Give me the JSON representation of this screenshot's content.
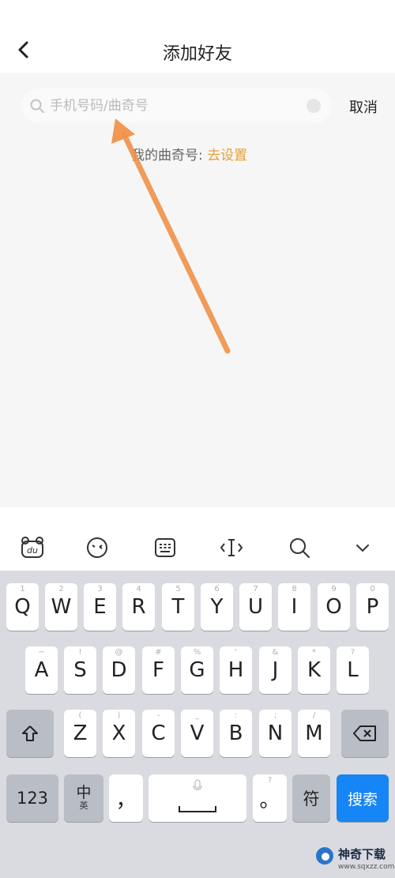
{
  "header": {
    "title": "添加好友"
  },
  "search": {
    "placeholder": "手机号码/曲奇号",
    "value": "",
    "cancel_label": "取消"
  },
  "quqi_id": {
    "label": "我的曲奇号:",
    "link_label": "去设置"
  },
  "keyboard_toolbar": {
    "items": [
      "du-logo-icon",
      "emoji-icon",
      "keyboard-icon",
      "cursor-icon",
      "search-icon",
      "chevron-down-icon"
    ]
  },
  "keyboard": {
    "row1": [
      {
        "key": "Q",
        "hint": "1"
      },
      {
        "key": "W",
        "hint": "2"
      },
      {
        "key": "E",
        "hint": "3"
      },
      {
        "key": "R",
        "hint": "4"
      },
      {
        "key": "T",
        "hint": "5"
      },
      {
        "key": "Y",
        "hint": "6"
      },
      {
        "key": "U",
        "hint": "7"
      },
      {
        "key": "I",
        "hint": "8"
      },
      {
        "key": "O",
        "hint": "9"
      },
      {
        "key": "P",
        "hint": "0"
      }
    ],
    "row2": [
      {
        "key": "A",
        "hint": "~"
      },
      {
        "key": "S",
        "hint": "!"
      },
      {
        "key": "D",
        "hint": "@"
      },
      {
        "key": "F",
        "hint": "#"
      },
      {
        "key": "G",
        "hint": "%"
      },
      {
        "key": "H",
        "hint": "'"
      },
      {
        "key": "J",
        "hint": "&"
      },
      {
        "key": "K",
        "hint": "*"
      },
      {
        "key": "L",
        "hint": "?"
      }
    ],
    "row3": [
      {
        "key": "Z",
        "hint": "("
      },
      {
        "key": "X",
        "hint": ")"
      },
      {
        "key": "C",
        "hint": "-"
      },
      {
        "key": "V",
        "hint": "_"
      },
      {
        "key": "B",
        "hint": ":"
      },
      {
        "key": "N",
        "hint": ";"
      },
      {
        "key": "M",
        "hint": "/"
      }
    ],
    "num_label": "123",
    "zh_top": "中",
    "zh_bottom": "英",
    "comma": "，",
    "comma_hint": "",
    "period": "。",
    "period_hint": "?",
    "symbol_label": "符",
    "search_label": "搜索"
  },
  "watermark": {
    "brand": "神奇下载",
    "url": "www.sqxzz.com"
  },
  "colors": {
    "accent_link": "#e0a23a",
    "search_key": "#1685f5",
    "arrow": "#f0924a"
  }
}
